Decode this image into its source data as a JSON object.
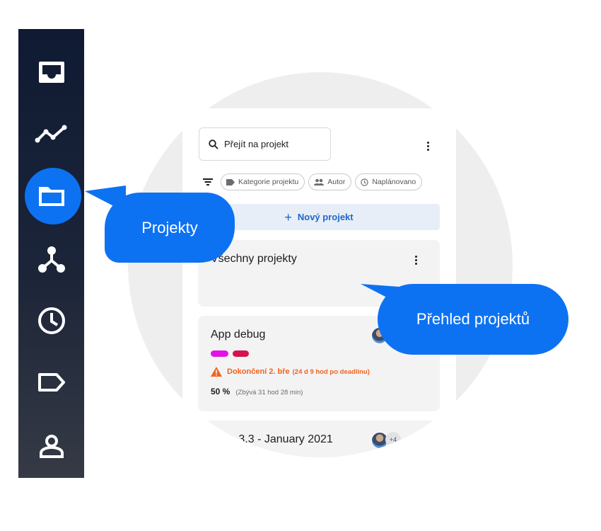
{
  "sidebar": {
    "items": [
      {
        "icon": "inbox-icon",
        "active": false
      },
      {
        "icon": "activity-chart-icon",
        "active": false
      },
      {
        "icon": "folder-icon",
        "active": true
      },
      {
        "icon": "hierarchy-icon",
        "active": false
      },
      {
        "icon": "clock-icon",
        "active": false
      },
      {
        "icon": "tag-icon",
        "active": false
      },
      {
        "icon": "user-icon",
        "active": false
      }
    ],
    "accent": "#0d72f2"
  },
  "search": {
    "placeholder": "Přejít na projekt"
  },
  "filters": [
    {
      "icon": "tag-icon",
      "label": "Kategorie projektu"
    },
    {
      "icon": "people-icon",
      "label": "Autor"
    },
    {
      "icon": "clock-icon",
      "label": "Naplánovano"
    }
  ],
  "new_project": {
    "label": "Nový projekt"
  },
  "cards": [
    {
      "title": "Všechny projekty"
    },
    {
      "title": "App debug",
      "tags": [
        "#e012e6",
        "#d6134f"
      ],
      "warning": "Dokončení 2. bře",
      "warning_detail": "(24 d 9 hod po deadlinu)",
      "progress": "50 %",
      "remaining": "(Zbývá 31 hod 28 min)"
    },
    {
      "title": "Time 3.3 - January 2021",
      "avatars_more": "+4"
    }
  ],
  "tooltips": {
    "left": "Projekty",
    "right": "Přehled projektů"
  }
}
